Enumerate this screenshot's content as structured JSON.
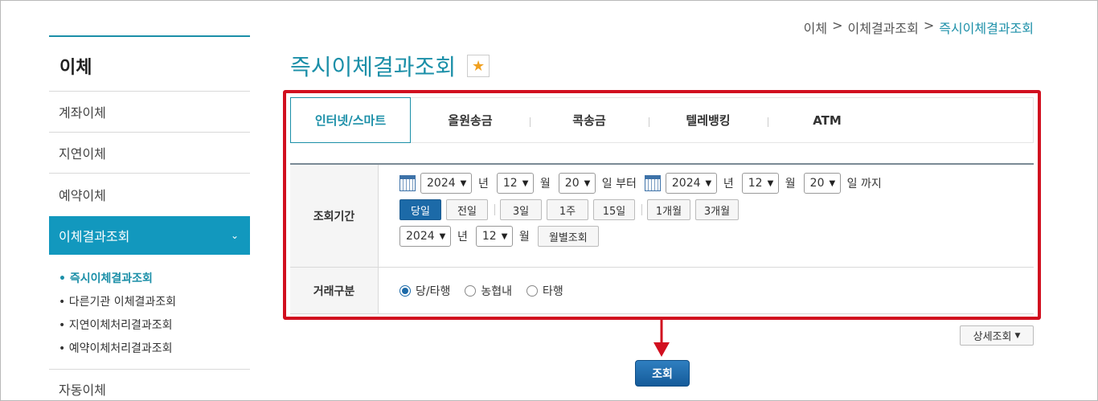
{
  "sidebar": {
    "title": "이체",
    "items": [
      "계좌이체",
      "지연이체",
      "예약이체"
    ],
    "active": "이체결과조회",
    "sub_items": [
      "즉시이체결과조회",
      "다른기관 이체결과조회",
      "지연이체처리결과조회",
      "예약이체처리결과조회"
    ],
    "last": "자동이체"
  },
  "breadcrumb": {
    "b1": "이체",
    "sep": ">",
    "b2": "이체결과조회",
    "b3": "즉시이체결과조회"
  },
  "page": {
    "title": "즉시이체결과조회",
    "star": "★"
  },
  "tabs": [
    "인터넷/스마트",
    "올원송금",
    "콕송금",
    "텔레뱅킹",
    "ATM"
  ],
  "form": {
    "period_label": "조회기간",
    "from": {
      "year": "2024",
      "month": "12",
      "day": "20"
    },
    "to": {
      "year": "2024",
      "month": "12",
      "day": "20"
    },
    "unit_year": "년",
    "unit_month": "월",
    "from_suffix": "일 부터",
    "to_suffix": "일 까지",
    "quick": [
      "당일",
      "전일",
      "3일",
      "1주",
      "15일",
      "1개월",
      "3개월"
    ],
    "monthly": {
      "year": "2024",
      "month": "12",
      "button": "월별조회"
    },
    "type_label": "거래구분",
    "radios": [
      "당/타행",
      "농협내",
      "타행"
    ]
  },
  "detail_button": "상세조회",
  "search_button": "조회",
  "colors": {
    "accent": "#1b8fa8",
    "active_bg": "#1298be",
    "highlight": "#d10f1f"
  }
}
